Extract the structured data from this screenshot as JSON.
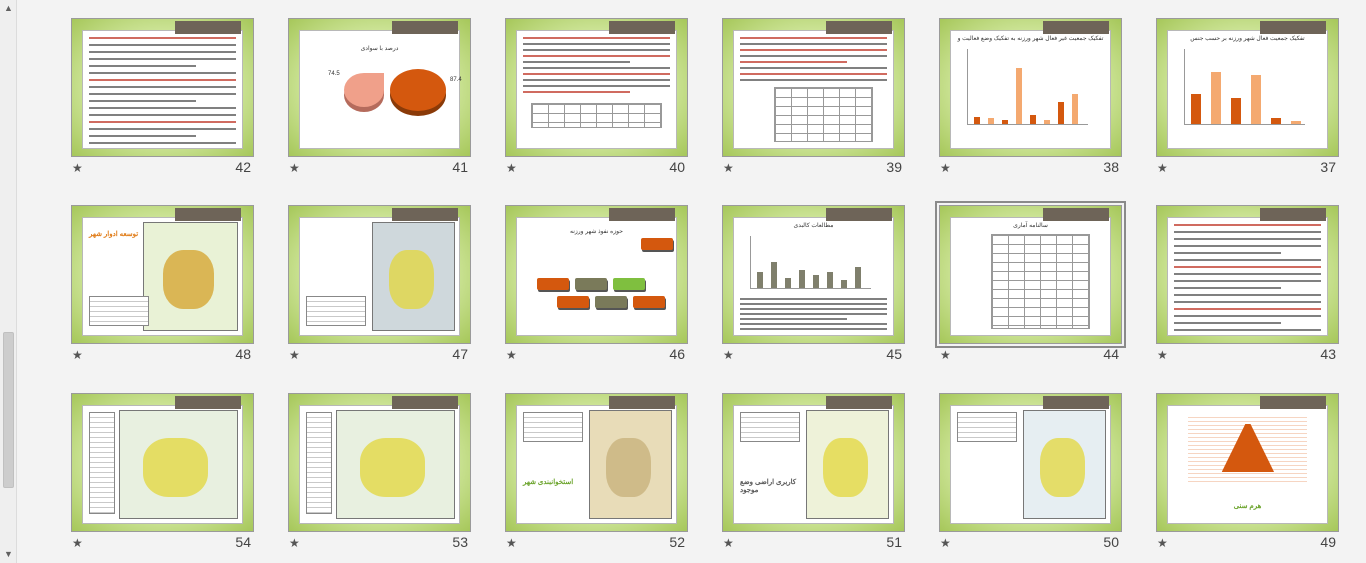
{
  "ui": {
    "star_glyph": "★",
    "scroll_up": "▲",
    "scroll_down": "▼"
  },
  "rows": [
    {
      "slides": [
        {
          "number": "37",
          "kind": "barchart",
          "title": "تفکیک جمعیت فعال شهر ورزنه بر حسب جنس"
        },
        {
          "number": "38",
          "kind": "barchart2",
          "title": "تفکیک جمعیت غیر فعال شهر ورزنه به تفکیک وضع فعالیت و"
        },
        {
          "number": "39",
          "kind": "table",
          "title": ""
        },
        {
          "number": "40",
          "kind": "text-table",
          "title": ""
        },
        {
          "number": "41",
          "kind": "pie",
          "title": "درصد با سوادی",
          "pie_values": [
            "74.5",
            "87.4"
          ]
        },
        {
          "number": "42",
          "kind": "text",
          "title": ""
        }
      ]
    },
    {
      "slides": [
        {
          "number": "43",
          "kind": "text",
          "title": ""
        },
        {
          "number": "44",
          "kind": "table2",
          "title": "سالنامه آماری",
          "selected": true
        },
        {
          "number": "45",
          "kind": "chart-text",
          "title": "مطالعات کالبدی"
        },
        {
          "number": "46",
          "kind": "blocks",
          "title": "حوزه نفوذ شهر ورزنه"
        },
        {
          "number": "47",
          "kind": "map",
          "title": ""
        },
        {
          "number": "48",
          "kind": "map2",
          "title": "توسعه ادوار شهر"
        }
      ]
    },
    {
      "slides": [
        {
          "number": "49",
          "kind": "pyramid",
          "title": "هرم سنی"
        },
        {
          "number": "50",
          "kind": "map3",
          "title": ""
        },
        {
          "number": "51",
          "kind": "map4",
          "title": "کاربری اراضی وضع موجود"
        },
        {
          "number": "52",
          "kind": "map5",
          "title": "استخوانبندی شهر"
        },
        {
          "number": "53",
          "kind": "map6",
          "title": ""
        },
        {
          "number": "54",
          "kind": "map6",
          "title": ""
        }
      ]
    }
  ]
}
